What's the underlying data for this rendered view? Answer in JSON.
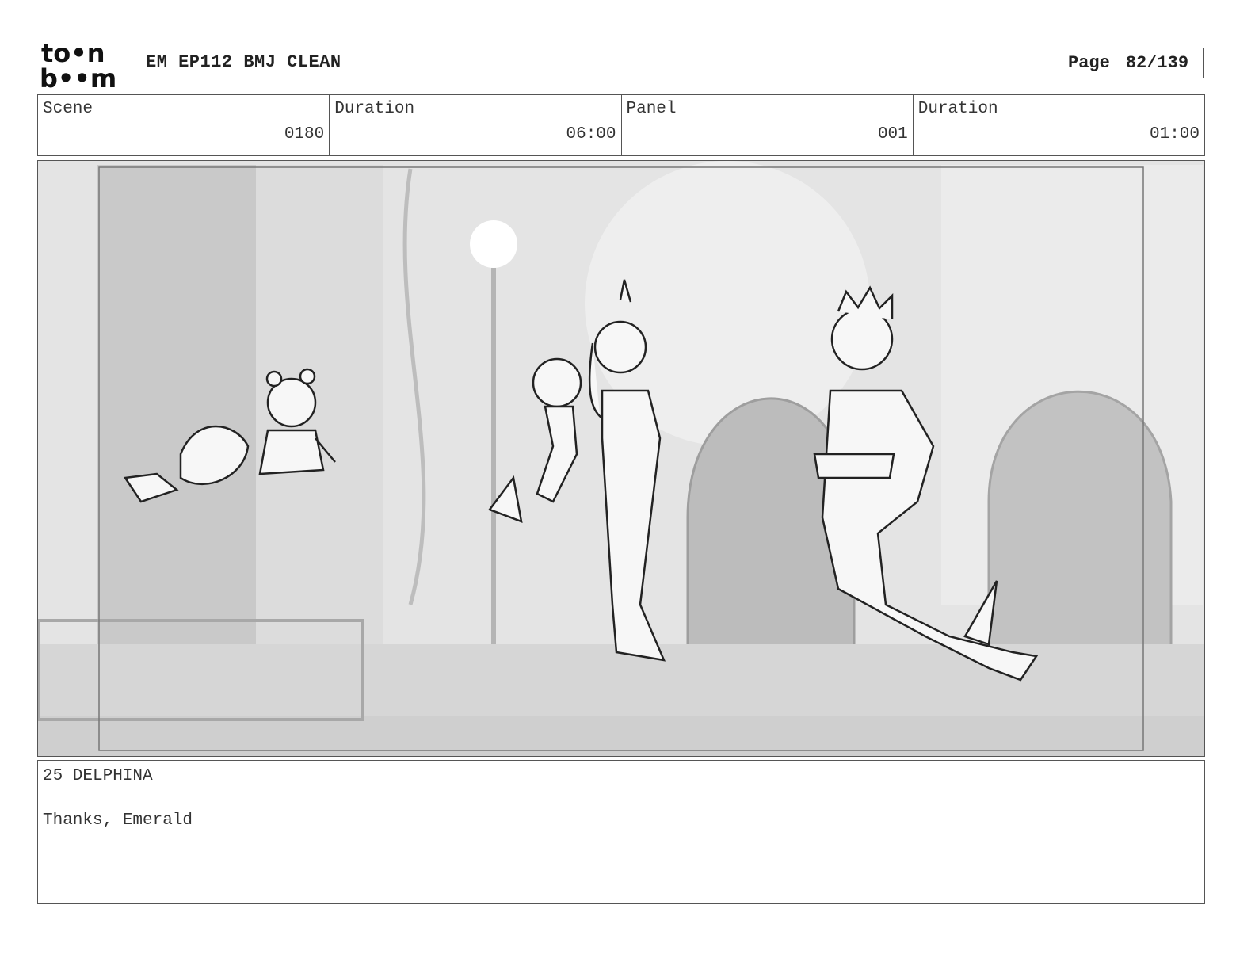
{
  "header": {
    "logo_top": "to•n",
    "logo_bottom": "b••m",
    "title": "EM EP112 BMJ CLEAN",
    "page_label": "Page",
    "page_value": "82/139"
  },
  "info": {
    "scene_label": "Scene",
    "scene_value": "0180",
    "scene_duration_label": "Duration",
    "scene_duration_value": "06:00",
    "panel_label": "Panel",
    "panel_value": "001",
    "panel_duration_label": "Duration",
    "panel_duration_value": "01:00"
  },
  "dialogue": {
    "line1": "25 DELPHINA",
    "line2": "",
    "line3": "Thanks, Emerald"
  },
  "colors": {
    "border": "#555555",
    "panel_background": "#e6e6e6"
  }
}
